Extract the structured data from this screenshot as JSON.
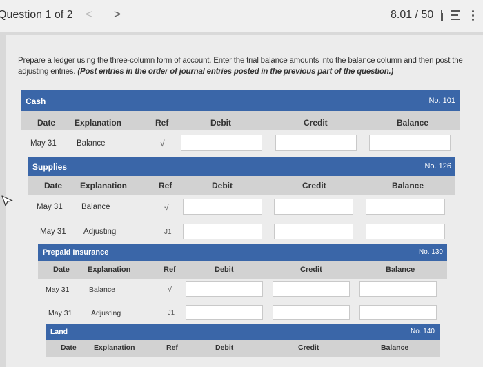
{
  "header": {
    "question": "Question 1 of 2",
    "prev": "<",
    "next": ">",
    "score": "8.01 / 50"
  },
  "instructions": {
    "text": "Prepare a ledger using the three-column form of account. Enter the trial balance amounts into the balance column and then post the adjusting entries. ",
    "emphasis": "(Post entries in the order of journal entries posted in the previous part of the question.)"
  },
  "columns": {
    "date": "Date",
    "explanation": "Explanation",
    "ref": "Ref",
    "debit": "Debit",
    "credit": "Credit",
    "balance": "Balance"
  },
  "accounts": [
    {
      "name": "Cash",
      "number": "No. 101",
      "rows": [
        {
          "date": "May 31",
          "explanation": "Balance",
          "ref": "√"
        }
      ]
    },
    {
      "name": "Supplies",
      "number": "No. 126",
      "rows": [
        {
          "date": "May 31",
          "explanation": "Balance",
          "ref": "√"
        },
        {
          "date": "May 31",
          "explanation": "Adjusting",
          "ref": "J1"
        }
      ]
    },
    {
      "name": "Prepaid Insurance",
      "number": "No. 130",
      "rows": [
        {
          "date": "May 31",
          "explanation": "Balance",
          "ref": "√"
        },
        {
          "date": "May 31",
          "explanation": "Adjusting",
          "ref": "J1"
        }
      ]
    },
    {
      "name": "Land",
      "number": "No. 140",
      "rows": []
    }
  ],
  "icons": {
    "cursor": "mouse-pointer-icon",
    "list": "list-icon",
    "more": "more-vertical-icon",
    "bars": "bars-icon"
  },
  "colors": {
    "accent": "#3a66a8",
    "column_header": "#d2d2d2",
    "panel": "#ececec"
  }
}
